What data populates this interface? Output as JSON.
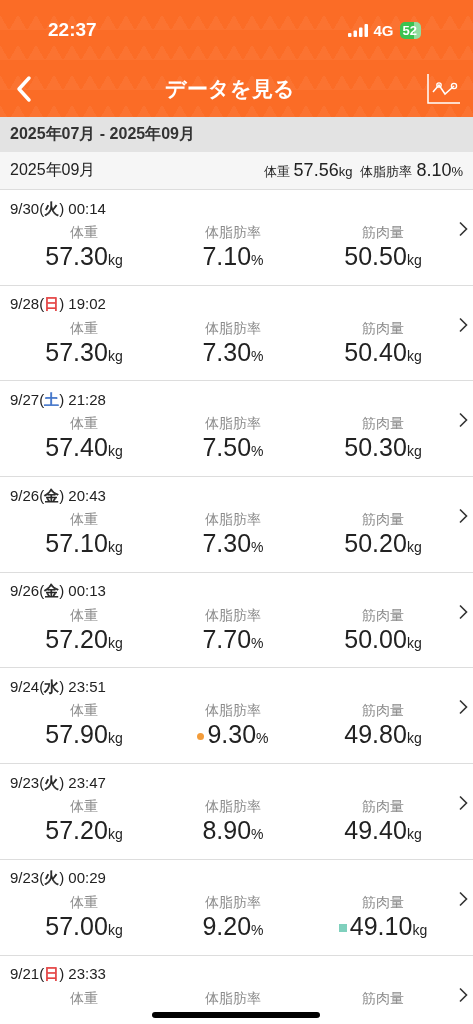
{
  "status_bar": {
    "time": "22:37",
    "network": "4G",
    "battery": "52"
  },
  "header": {
    "title": "データを見る"
  },
  "period": {
    "label": "2025年07月 - 2025年09月"
  },
  "month_summary": {
    "month": "2025年09月",
    "items": [
      {
        "label": "体重",
        "value": "57.56",
        "unit": "kg"
      },
      {
        "label": "体脂肪率",
        "value": "8.10",
        "unit": "%"
      }
    ]
  },
  "records": [
    {
      "date": "9/30(",
      "weekday": "火",
      "color": "#222222",
      "time": ") 00:14",
      "metrics": [
        {
          "label": "体重",
          "value": "57.30",
          "unit": "kg"
        },
        {
          "label": "体脂肪率",
          "value": "7.10",
          "unit": "%"
        },
        {
          "label": "筋肉量",
          "value": "50.50",
          "unit": "kg"
        }
      ]
    },
    {
      "date": "9/28(",
      "weekday": "日",
      "color": "#e23b3b",
      "time": ") 19:02",
      "metrics": [
        {
          "label": "体重",
          "value": "57.30",
          "unit": "kg"
        },
        {
          "label": "体脂肪率",
          "value": "7.30",
          "unit": "%"
        },
        {
          "label": "筋肉量",
          "value": "50.40",
          "unit": "kg"
        }
      ]
    },
    {
      "date": "9/27(",
      "weekday": "土",
      "color": "#3b6fc7",
      "time": ") 21:28",
      "metrics": [
        {
          "label": "体重",
          "value": "57.40",
          "unit": "kg"
        },
        {
          "label": "体脂肪率",
          "value": "7.50",
          "unit": "%"
        },
        {
          "label": "筋肉量",
          "value": "50.30",
          "unit": "kg"
        }
      ]
    },
    {
      "date": "9/26(",
      "weekday": "金",
      "color": "#222222",
      "time": ") 20:43",
      "metrics": [
        {
          "label": "体重",
          "value": "57.10",
          "unit": "kg"
        },
        {
          "label": "体脂肪率",
          "value": "7.30",
          "unit": "%"
        },
        {
          "label": "筋肉量",
          "value": "50.20",
          "unit": "kg"
        }
      ]
    },
    {
      "date": "9/26(",
      "weekday": "金",
      "color": "#222222",
      "time": ") 00:13",
      "metrics": [
        {
          "label": "体重",
          "value": "57.20",
          "unit": "kg"
        },
        {
          "label": "体脂肪率",
          "value": "7.70",
          "unit": "%"
        },
        {
          "label": "筋肉量",
          "value": "50.00",
          "unit": "kg"
        }
      ]
    },
    {
      "date": "9/24(",
      "weekday": "水",
      "color": "#222222",
      "time": ") 23:51",
      "metrics": [
        {
          "label": "体重",
          "value": "57.90",
          "unit": "kg"
        },
        {
          "label": "体脂肪率",
          "value": "9.30",
          "unit": "%",
          "marker": {
            "kind": "dot",
            "color": "#f39c3a"
          }
        },
        {
          "label": "筋肉量",
          "value": "49.80",
          "unit": "kg"
        }
      ]
    },
    {
      "date": "9/23(",
      "weekday": "火",
      "color": "#222222",
      "time": ") 23:47",
      "metrics": [
        {
          "label": "体重",
          "value": "57.20",
          "unit": "kg"
        },
        {
          "label": "体脂肪率",
          "value": "8.90",
          "unit": "%"
        },
        {
          "label": "筋肉量",
          "value": "49.40",
          "unit": "kg"
        }
      ]
    },
    {
      "date": "9/23(",
      "weekday": "火",
      "color": "#222222",
      "time": ") 00:29",
      "metrics": [
        {
          "label": "体重",
          "value": "57.00",
          "unit": "kg"
        },
        {
          "label": "体脂肪率",
          "value": "9.20",
          "unit": "%"
        },
        {
          "label": "筋肉量",
          "value": "49.10",
          "unit": "kg",
          "marker": {
            "kind": "square",
            "color": "#7fd0bd"
          }
        }
      ]
    },
    {
      "date": "9/21(",
      "weekday": "日",
      "color": "#e23b3b",
      "time": ") 23:33",
      "metrics": [
        {
          "label": "体重"
        },
        {
          "label": "体脂肪率"
        },
        {
          "label": "筋肉量"
        }
      ]
    }
  ]
}
